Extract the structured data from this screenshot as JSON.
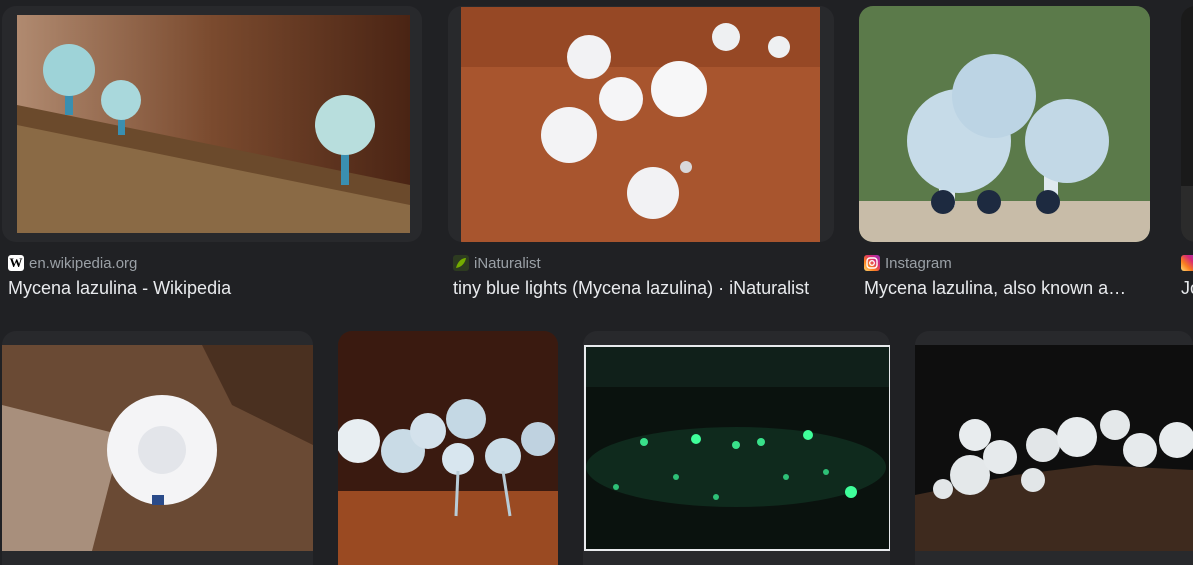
{
  "results": [
    {
      "source": "en.wikipedia.org",
      "favicon": "wikipedia-icon",
      "title": "Mycena lazulina - Wikipedia"
    },
    {
      "source": "iNaturalist",
      "favicon": "inaturalist-icon",
      "title": "tiny blue lights (Mycena lazulina) · iNaturalist"
    },
    {
      "source": "Instagram",
      "favicon": "instagram-icon",
      "title": "Mycena lazulina, also known a…"
    },
    {
      "source": "",
      "favicon": "instagram-icon",
      "title": "Jo"
    }
  ],
  "colors": {
    "background": "#202124",
    "card": "#28292c",
    "source_text": "#9aa0a6",
    "title_text": "#e8eaed"
  }
}
